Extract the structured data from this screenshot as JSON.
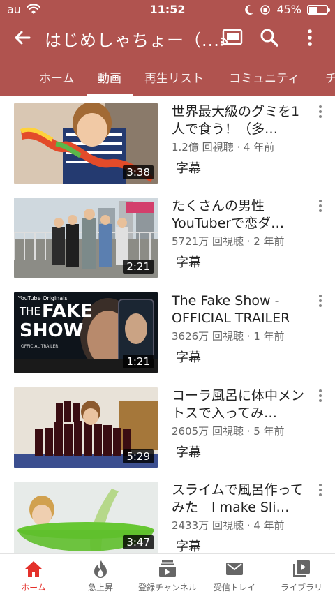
{
  "statusbar": {
    "carrier": "au",
    "time": "11:52",
    "battery": "45%",
    "battery_level": 0.45
  },
  "appbar": {
    "title": "はじめしゃちょー（..."
  },
  "tabs": [
    "ホーム",
    "動画",
    "再生リスト",
    "コミュニティ",
    "チ"
  ],
  "videos": [
    {
      "title": "世界最大級のグミを1人で食う！（多…",
      "meta": "1.2億 回視聴 · 4 年前",
      "duration": "3:38",
      "caption": "字幕"
    },
    {
      "title": "たくさんの男性YouTuberで恋ダ…",
      "meta": "5721万 回視聴 · 2 年前",
      "duration": "2:21",
      "caption": "字幕"
    },
    {
      "title": "The Fake Show - OFFICIAL TRAILER",
      "meta": "3626万 回視聴 · 1 年前",
      "duration": "1:21",
      "caption": "字幕",
      "thumb_text": {
        "brand": "YouTube Originals",
        "the": "THE",
        "fake": "FAKE",
        "show": "SHOW",
        "sub": "OFFICIAL TRAILER"
      }
    },
    {
      "title": "コーラ風呂に体中メントスで入ってみ…",
      "meta": "2605万 回視聴 · 5 年前",
      "duration": "5:29",
      "caption": "字幕"
    },
    {
      "title": "スライムで風呂作ってみた　I make Sli…",
      "meta": "2433万 回視聴 · 4 年前",
      "duration": "3:47",
      "caption": "字幕"
    }
  ],
  "bottomnav": [
    {
      "label": "ホーム",
      "icon": "home-icon"
    },
    {
      "label": "急上昇",
      "icon": "flame-icon"
    },
    {
      "label": "登録チャンネル",
      "icon": "subscriptions-icon"
    },
    {
      "label": "受信トレイ",
      "icon": "inbox-mail-icon"
    },
    {
      "label": "ライブラリ",
      "icon": "library-icon"
    }
  ],
  "colors": {
    "brand": "#b0534f",
    "active_nav": "#e4312b"
  }
}
